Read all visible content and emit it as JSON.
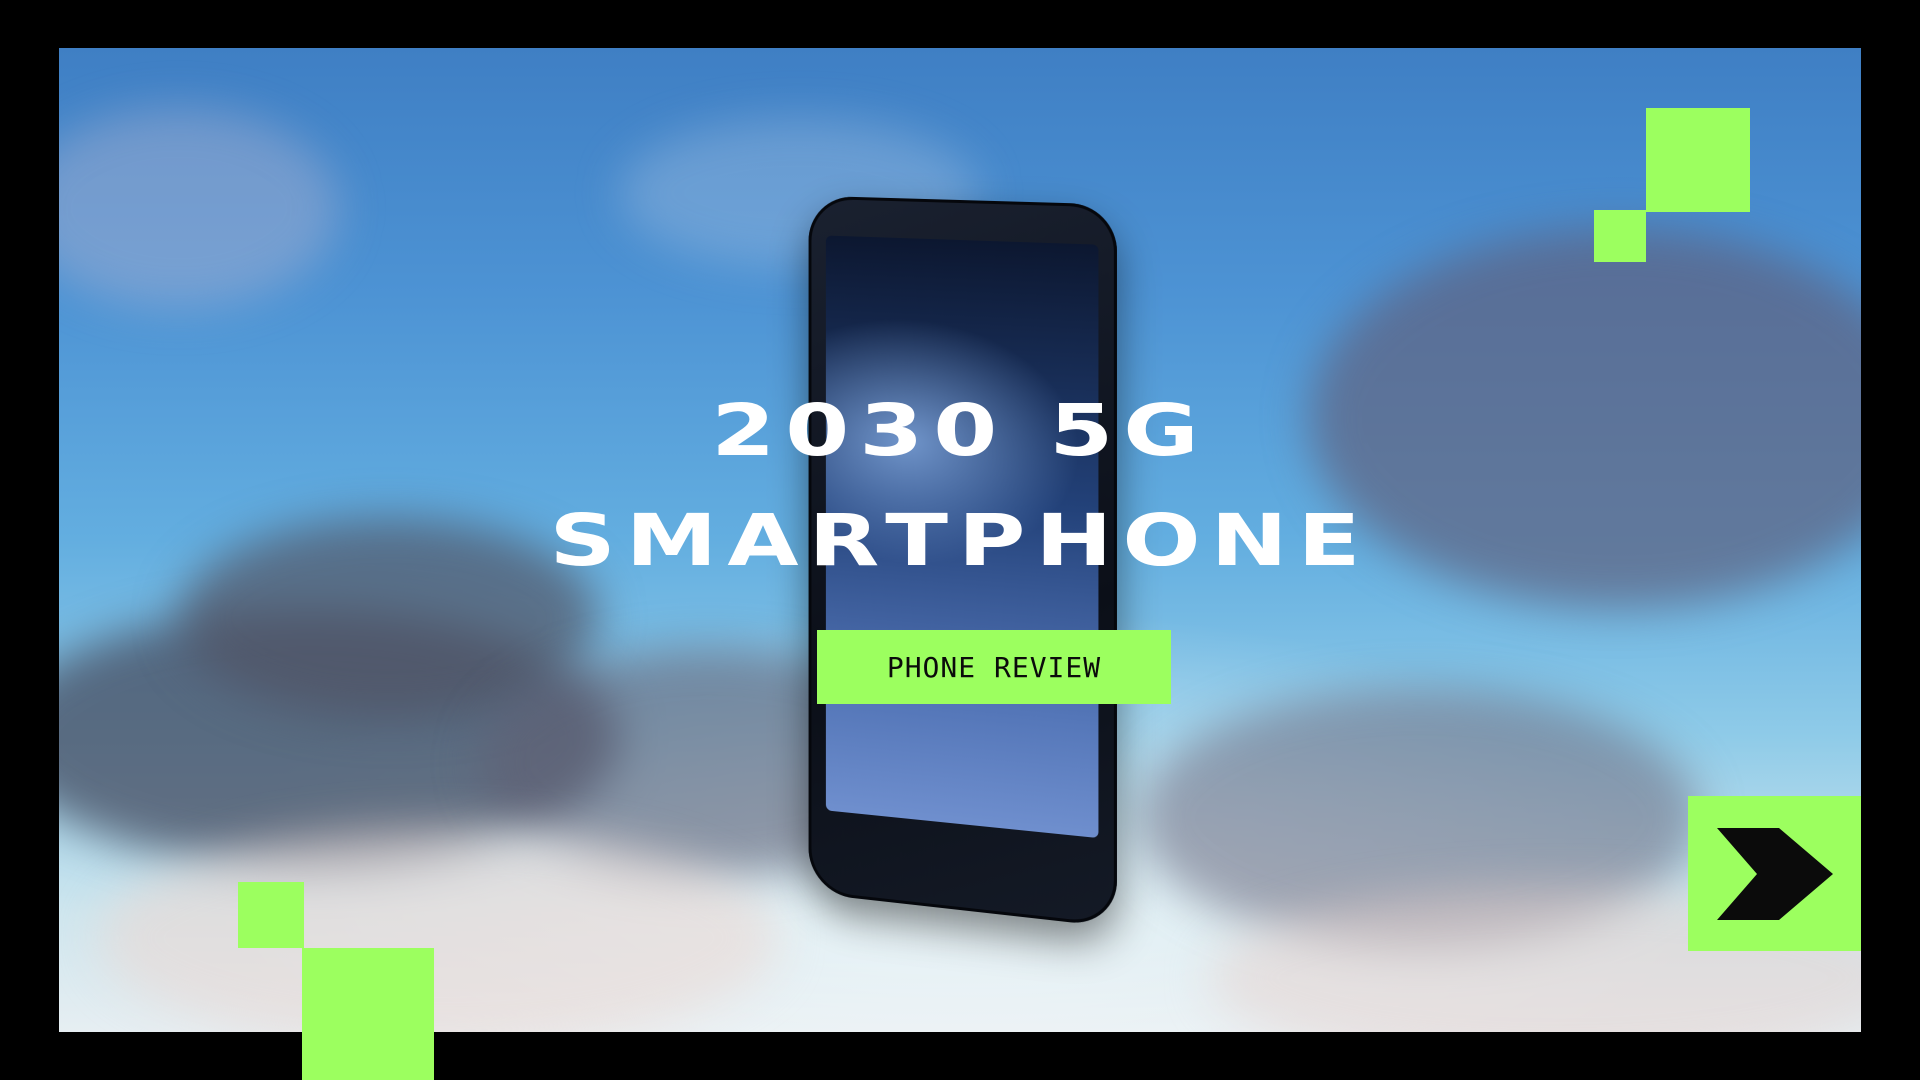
{
  "hero": {
    "title_line1": "2030 5G",
    "title_line2": "SMARTPHONE",
    "badge_label": "PHONE REVIEW"
  },
  "navigation": {
    "next_icon": "chevron-right-icon"
  },
  "colors": {
    "accent": "#9cff5f",
    "background": "#000000",
    "title_text": "#ffffff",
    "badge_text": "#0b0b0b"
  }
}
